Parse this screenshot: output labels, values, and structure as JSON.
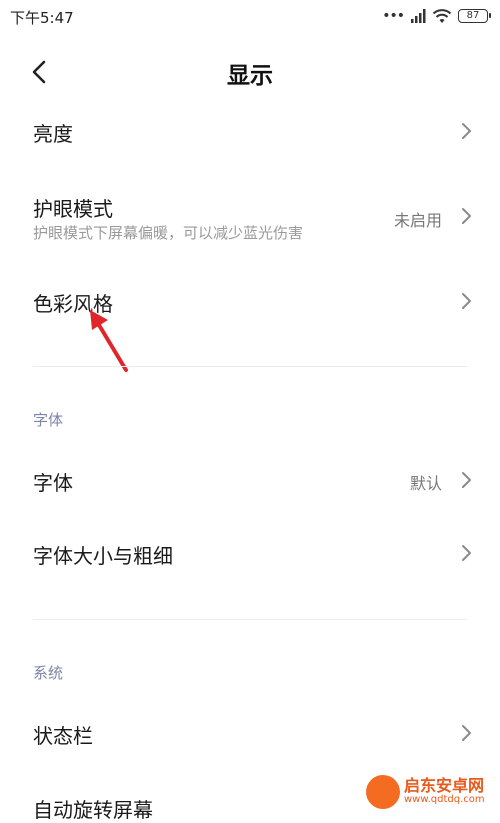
{
  "status_bar": {
    "time": "下午5:47",
    "signal_dots": "•••",
    "battery": "87"
  },
  "header": {
    "title": "显示",
    "back_icon": "chevron-left-icon"
  },
  "rows": {
    "brightness": {
      "title": "亮度"
    },
    "eye_care": {
      "title": "护眼模式",
      "subtitle": "护眼模式下屏幕偏暖，可以减少蓝光伤害",
      "value": "未启用"
    },
    "color_style": {
      "title": "色彩风格"
    },
    "font": {
      "title": "字体",
      "value": "默认"
    },
    "font_size": {
      "title": "字体大小与粗细"
    },
    "status_bar": {
      "title": "状态栏"
    },
    "auto_rotate": {
      "title": "自动旋转屏幕"
    }
  },
  "sections": {
    "font": "字体",
    "system": "系统"
  },
  "watermark": {
    "main": "启东安卓网",
    "sub": "www.qdtdq.com"
  },
  "colors": {
    "section_label": "#7c84a6",
    "annotation_arrow": "#e0262b",
    "chevron": "#8a8a8a"
  }
}
